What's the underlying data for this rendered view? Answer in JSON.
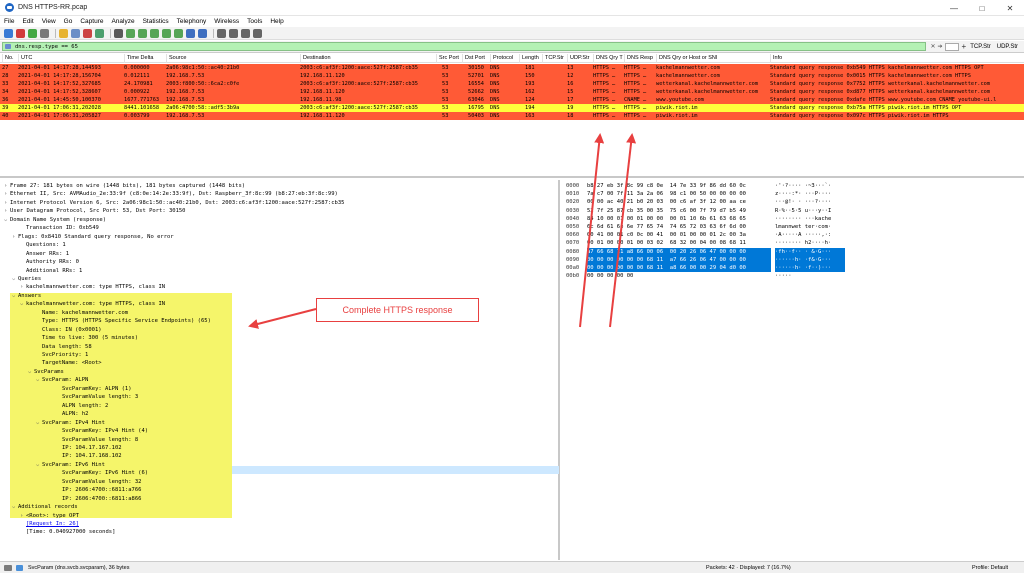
{
  "window": {
    "title": "DNS HTTPS-RR.pcap",
    "minimize": "—",
    "maximize": "□",
    "close": "✕"
  },
  "menu": [
    "File",
    "Edit",
    "View",
    "Go",
    "Capture",
    "Analyze",
    "Statistics",
    "Telephony",
    "Wireless",
    "Tools",
    "Help"
  ],
  "filter": {
    "value": "dns.resp.type == 65",
    "tcp_btn": "TCP.Str",
    "udp_btn": "UDP.Str"
  },
  "packet_list": {
    "columns": [
      "No.",
      "UTC",
      "Time Delta",
      "Source",
      "Destination",
      "Src Port",
      "Dst Port",
      "Protocol",
      "Length",
      "TCP.Str",
      "UDP.Str",
      "DNS Qry T",
      "DNS Resp",
      "DNS Qry or Host or SNI",
      "Info"
    ],
    "rows": [
      {
        "no": "27",
        "utc": "2021-04-01 14:17:28,144593",
        "delta": "0.000000",
        "src": "2a06:98c1:50::ac40:21b0",
        "dst": "2003:c6:af3f:1200:aace:527f:2587:cb35",
        "sport": "53",
        "dport": "30150",
        "proto": "DNS",
        "len": "181",
        "tcp": "",
        "udp": "13",
        "qry": "HTTPS …",
        "resp": "HTTPS …",
        "host": "kachelmannwetter.com",
        "info": "Standard query response 0xb549 HTTPS kachelmannwetter.com HTTPS OPT",
        "color": "#ff5a36",
        "text": "#000"
      },
      {
        "no": "28",
        "utc": "2021-04-01 14:17:28,156704",
        "delta": "0.012111",
        "src": "192.168.7.53",
        "dst": "192.168.11.120",
        "sport": "53",
        "dport": "52701",
        "proto": "DNS",
        "len": "150",
        "tcp": "",
        "udp": "12",
        "qry": "HTTPS …",
        "resp": "HTTPS …",
        "host": "kachelmannwetter.com",
        "info": "Standard query response 0x0015 HTTPS kachelmannwetter.com HTTPS",
        "color": "#ff5a36",
        "text": "#000"
      },
      {
        "no": "33",
        "utc": "2021-04-01 14:17:52,327685",
        "delta": "24.170981",
        "src": "2003:f800:50::6ca2:c0fe",
        "dst": "2003:c6:af3f:1200:aace:527f:2587:cb35",
        "sport": "53",
        "dport": "16554",
        "proto": "DNS",
        "len": "193",
        "tcp": "",
        "udp": "16",
        "qry": "HTTPS …",
        "resp": "HTTPS …",
        "host": "wetterkanal.kachelmannwetter.com",
        "info": "Standard query response 0x7752 HTTPS wetterkanal.kachelmannwetter.com",
        "color": "#ff5a36",
        "text": "#000"
      },
      {
        "no": "34",
        "utc": "2021-04-01 14:17:52,328607",
        "delta": "0.000922",
        "src": "192.168.7.53",
        "dst": "192.168.11.120",
        "sport": "53",
        "dport": "52662",
        "proto": "DNS",
        "len": "162",
        "tcp": "",
        "udp": "15",
        "qry": "HTTPS …",
        "resp": "HTTPS …",
        "host": "wetterkanal.kachelmannwetter.com",
        "info": "Standard query response 0xd877 HTTPS wetterkanal.kachelmannwetter.com",
        "color": "#ff5a36",
        "text": "#000"
      },
      {
        "no": "36",
        "utc": "2021-04-01 14:45:50,100370",
        "delta": "1677.771763",
        "src": "192.168.7.53",
        "dst": "192.168.11.98",
        "sport": "53",
        "dport": "63046",
        "proto": "DNS",
        "len": "124",
        "tcp": "",
        "udp": "17",
        "qry": "HTTPS …",
        "resp": "CNAME …",
        "host": "www.youtube.com",
        "info": "Standard query response 0xdafe HTTPS www.youtube.com CNAME youtube-ui.l",
        "color": "#ff5a36",
        "text": "#000"
      },
      {
        "no": "39",
        "utc": "2021-04-01 17:06:31,202028",
        "delta": "8441.101658",
        "src": "2a06:4700:58::adf5:3b9a",
        "dst": "2003:c6:af3f:1200:aace:527f:2587:cb35",
        "sport": "53",
        "dport": "16795",
        "proto": "DNS",
        "len": "194",
        "tcp": "",
        "udp": "19",
        "qry": "HTTPS …",
        "resp": "HTTPS …",
        "host": "piwik.riot.im",
        "info": "Standard query response 0xb75a HTTPS piwik.riot.im HTTPS OPT",
        "color": "#ffff3c",
        "text": "#000"
      },
      {
        "no": "40",
        "utc": "2021-04-01 17:06:31,205827",
        "delta": "0.003799",
        "src": "192.168.7.53",
        "dst": "192.168.11.120",
        "sport": "53",
        "dport": "50403",
        "proto": "DNS",
        "len": "163",
        "tcp": "",
        "udp": "18",
        "qry": "HTTPS …",
        "resp": "HTTPS …",
        "host": "piwik.riot.im",
        "info": "Standard query response 0x097c HTTPS piwik.riot.im HTTPS",
        "color": "#ff5a36",
        "text": "#000"
      }
    ]
  },
  "detail": {
    "lines": [
      {
        "t": ">",
        "x": 0,
        "text": "Frame 27: 181 bytes on wire (1448 bits), 181 bytes captured (1448 bits)"
      },
      {
        "t": ">",
        "x": 0,
        "text": "Ethernet II, Src: AVMAudio_2e:33:9f (c8:0e:14:2e:33:9f), Dst: Raspberr_3f:8c:99 (b8:27:eb:3f:8c:99)"
      },
      {
        "t": ">",
        "x": 0,
        "text": "Internet Protocol Version 6, Src: 2a06:98c1:50::ac40:21b0, Dst: 2003:c6:af3f:1200:aace:527f:2587:cb35"
      },
      {
        "t": ">",
        "x": 0,
        "text": "User Datagram Protocol, Src Port: 53, Dst Port: 30150"
      },
      {
        "t": "v",
        "x": 0,
        "text": "Domain Name System (response)"
      },
      {
        "t": "",
        "x": 16,
        "text": "Transaction ID: 0xb549"
      },
      {
        "t": ">",
        "x": 8,
        "text": "Flags: 0x8410 Standard query response, No error"
      },
      {
        "t": "",
        "x": 16,
        "text": "Questions: 1"
      },
      {
        "t": "",
        "x": 16,
        "text": "Answer RRs: 1"
      },
      {
        "t": "",
        "x": 16,
        "text": "Authority RRs: 0"
      },
      {
        "t": "",
        "x": 16,
        "text": "Additional RRs: 1"
      },
      {
        "t": "v",
        "x": 8,
        "text": "Queries"
      },
      {
        "t": ">",
        "x": 16,
        "text": "kachelmannwetter.com: type HTTPS, class IN"
      },
      {
        "t": "v",
        "x": 8,
        "text": "Answers"
      },
      {
        "t": "v",
        "x": 16,
        "text": "kachelmannwetter.com: type HTTPS, class IN"
      },
      {
        "t": "",
        "x": 32,
        "text": "Name: kachelmannwetter.com"
      },
      {
        "t": "",
        "x": 32,
        "text": "Type: HTTPS (HTTPS Specific Service Endpoints) (65)"
      },
      {
        "t": "",
        "x": 32,
        "text": "Class: IN (0x0001)"
      },
      {
        "t": "",
        "x": 32,
        "text": "Time to live: 300 (5 minutes)"
      },
      {
        "t": "",
        "x": 32,
        "text": "Data length: 58"
      },
      {
        "t": "",
        "x": 32,
        "text": "SvcPriority: 1"
      },
      {
        "t": "",
        "x": 32,
        "text": "TargetName: <Root>"
      },
      {
        "t": "v",
        "x": 24,
        "text": "SvcParams"
      },
      {
        "t": "v",
        "x": 32,
        "text": "SvcParam: ALPN"
      },
      {
        "t": "",
        "x": 52,
        "text": "SvcParamKey: ALPN (1)"
      },
      {
        "t": "",
        "x": 52,
        "text": "SvcParamValue length: 3"
      },
      {
        "t": "",
        "x": 52,
        "text": "ALPN length: 2"
      },
      {
        "t": "",
        "x": 52,
        "text": "ALPN: h2"
      },
      {
        "t": "v",
        "x": 32,
        "text": "SvcParam: IPv4 Hint"
      },
      {
        "t": "",
        "x": 52,
        "text": "SvcParamKey: IPv4 Hint (4)"
      },
      {
        "t": "",
        "x": 52,
        "text": "SvcParamValue length: 8"
      },
      {
        "t": "",
        "x": 52,
        "text": "IP: 104.17.167.102"
      },
      {
        "t": "",
        "x": 52,
        "text": "IP: 104.17.168.102"
      },
      {
        "t": "v",
        "x": 32,
        "text": "SvcParam: IPv6 Hint"
      },
      {
        "t": "",
        "x": 52,
        "text": "SvcParamKey: IPv6 Hint (6)"
      },
      {
        "t": "",
        "x": 52,
        "text": "SvcParamValue length: 32"
      },
      {
        "t": "",
        "x": 52,
        "text": "IP: 2606:4700::6811:a766"
      },
      {
        "t": "",
        "x": 52,
        "text": "IP: 2606:4700::6811:a866"
      },
      {
        "t": "v",
        "x": 8,
        "text": "Additional records"
      },
      {
        "t": ">",
        "x": 16,
        "text": "<Root>: type OPT"
      },
      {
        "t": "",
        "x": 16,
        "text": "[Request In: 26]",
        "link": true
      },
      {
        "t": "",
        "x": 16,
        "text": "[Time: 0.040927000 seconds]"
      }
    ]
  },
  "bytes": {
    "rows": [
      {
        "off": "0000",
        "hex": "b8 27 eb 3f 8c 99 c8 0e  14 7e 33 9f 86 dd 60 0c",
        "asc": "·'·?···· ·~3···`·"
      },
      {
        "off": "0010",
        "hex": "7a c7 00 7f 11 3a 2a 06  98 c1 00 50 00 00 00 00",
        "asc": "z····:*· ···P····"
      },
      {
        "off": "0020",
        "hex": "00 00 ac 40 21 b0 20 03  00 c6 af 3f 12 00 aa ce",
        "asc": "···@!· · ···?····"
      },
      {
        "off": "0030",
        "hex": "52 7f 25 87 cb 35 00 35  75 c6 00 7f 79 d7 b5 49",
        "asc": "R·%··5·5 u···y··I"
      },
      {
        "off": "0040",
        "hex": "84 10 00 01 00 01 00 00  00 01 10 6b 61 63 68 65",
        "asc": "········ ···kache"
      },
      {
        "off": "0050",
        "hex": "6c 6d 61 6e 6e 77 65 74  74 65 72 03 63 6f 6d 00",
        "asc": "lmannwet ter·com·"
      },
      {
        "off": "0060",
        "hex": "00 41 00 01 c0 0c 00 41  00 01 00 00 01 2c 00 3a",
        "asc": "·A·····A ·····,·:"
      },
      {
        "off": "0070",
        "hex": "00 01 00 00 01 00 03 02  68 32 00 04 00 08 68 11",
        "asc": "········ h2····h·"
      },
      {
        "off": "0080",
        "hex": "a7 66 68 11 a8 66 00 06  00 20 26 06 47 00 00 00",
        "asc": "·fh··f·· · &·G···"
      },
      {
        "off": "0090",
        "hex": "00 00 00 00 00 00 68 11  a7 66 26 06 47 00 00 00",
        "asc": "······h· ·f&·G···"
      },
      {
        "off": "00a0",
        "hex": "00 00 00 00 00 00 68 11  a8 66 00 00 29 04 d0 00",
        "asc": "······h· ·f··)···"
      },
      {
        "off": "00b0",
        "hex": "00 00 00 00 00",
        "asc": "·····"
      }
    ]
  },
  "status": {
    "left": "SvcParam (dns.svcb.svcparam), 36 bytes",
    "middle": "Packets: 42 · Displayed: 7 (16.7%)",
    "right": "Profile: Default"
  },
  "annotation": {
    "callout_text": "Complete HTTPS response",
    "color": "#e84040"
  },
  "colors": {
    "row_red": "#ff5a36",
    "row_yellow": "#ffff3c",
    "filter_green": "#b4f1b4",
    "highlight": "#f5f56a",
    "selection": "#0078d7"
  }
}
